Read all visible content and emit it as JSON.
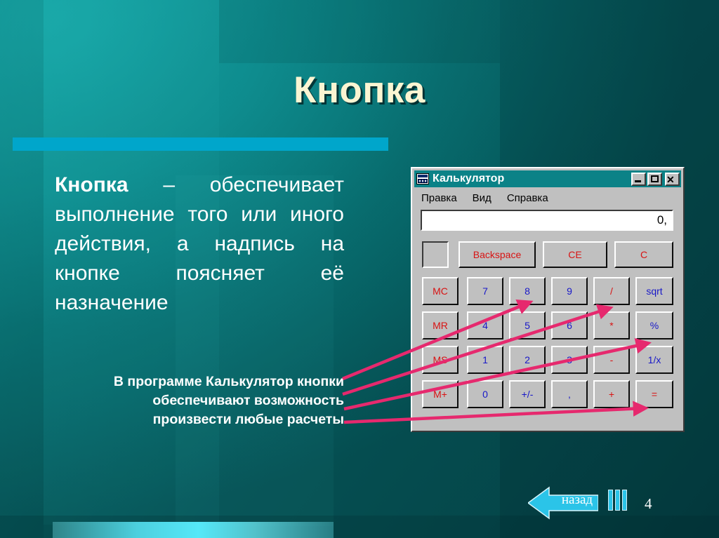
{
  "slide": {
    "title": "Кнопка",
    "page_number": "4",
    "body_paragraph_lead": "Кнопка",
    "body_paragraph_rest": " – обеспечивает выполнение того или иного действия, а надпись на кнопке поясняет её назначение",
    "note_line1": "В программе Калькулятор кнопки",
    "note_line2": "обеспечивают возможность",
    "note_line3": "произвести любые расчеты"
  },
  "nav": {
    "back_label": "назад",
    "arrow_icon": "arrow-left-icon"
  },
  "colors": {
    "background_light": "#16a0a0",
    "background_dark": "#054f52",
    "accent_bar": "#00a6cb",
    "title_text": "#faf5d2",
    "arrow_pink": "#e6296e",
    "nav_cyan": "#2bc4e8",
    "calc_face": "#c0c0c0",
    "calc_titlebar": "#0b8287",
    "btn_red": "#d81313",
    "btn_blue": "#1818c8"
  },
  "calculator": {
    "window_title": "Калькулятор",
    "window_icon": "calculator-icon",
    "window_controls": [
      {
        "name": "minimize-button",
        "glyph": "_"
      },
      {
        "name": "maximize-button",
        "glyph": "□"
      },
      {
        "name": "close-button",
        "glyph": "✕"
      }
    ],
    "menu": [
      "Правка",
      "Вид",
      "Справка"
    ],
    "display_value": "0,",
    "memory_indicator": "",
    "function_row": [
      {
        "label": "Backspace",
        "color": "red"
      },
      {
        "label": "CE",
        "color": "red"
      },
      {
        "label": "C",
        "color": "red"
      }
    ],
    "keypad": [
      [
        {
          "label": "MC",
          "color": "red"
        },
        {
          "label": "7",
          "color": "blue"
        },
        {
          "label": "8",
          "color": "blue"
        },
        {
          "label": "9",
          "color": "blue"
        },
        {
          "label": "/",
          "color": "red"
        },
        {
          "label": "sqrt",
          "color": "blue"
        }
      ],
      [
        {
          "label": "MR",
          "color": "red"
        },
        {
          "label": "4",
          "color": "blue"
        },
        {
          "label": "5",
          "color": "blue"
        },
        {
          "label": "6",
          "color": "blue"
        },
        {
          "label": "*",
          "color": "red"
        },
        {
          "label": "%",
          "color": "blue"
        }
      ],
      [
        {
          "label": "MS",
          "color": "red"
        },
        {
          "label": "1",
          "color": "blue"
        },
        {
          "label": "2",
          "color": "blue"
        },
        {
          "label": "3",
          "color": "blue"
        },
        {
          "label": "-",
          "color": "red"
        },
        {
          "label": "1/x",
          "color": "blue"
        }
      ],
      [
        {
          "label": "M+",
          "color": "red"
        },
        {
          "label": "0",
          "color": "blue"
        },
        {
          "label": "+/-",
          "color": "blue"
        },
        {
          "label": ",",
          "color": "blue"
        },
        {
          "label": "+",
          "color": "red"
        },
        {
          "label": "=",
          "color": "red"
        }
      ]
    ]
  }
}
